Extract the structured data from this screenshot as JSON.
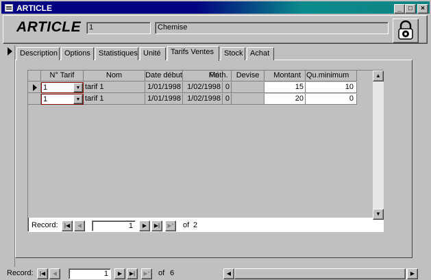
{
  "window": {
    "title": "ARTICLE",
    "min_label": "_",
    "max_label": "□",
    "close_label": "×"
  },
  "form": {
    "title": "ARTICLE",
    "id_value": "1",
    "name_value": "Chemise"
  },
  "tabs": [
    {
      "label": "Description"
    },
    {
      "label": "Options"
    },
    {
      "label": "Statistiques"
    },
    {
      "label": "Unité"
    },
    {
      "label": "Tarifs Ventes",
      "active": true
    },
    {
      "label": "Stock"
    },
    {
      "label": "Achat"
    }
  ],
  "subform": {
    "columns": [
      "N° Tarif",
      "Nom",
      "Date début",
      "Fin",
      "Méth.",
      "Devise",
      "Montant",
      "Qu.minimum"
    ],
    "rows": [
      {
        "tarif": "1",
        "nom": "tarif 1",
        "debut": "1/01/1998",
        "fin": "1/02/1998",
        "meth": "0",
        "devise": "",
        "montant": "15",
        "qmin": "10"
      },
      {
        "tarif": "1",
        "nom": "tarif 1",
        "debut": "1/01/1998",
        "fin": "1/02/1998",
        "meth": "0",
        "devise": "",
        "montant": "20",
        "qmin": "0"
      }
    ],
    "nav": {
      "label": "Record:",
      "current": "1",
      "of": "of",
      "total": "2"
    }
  },
  "mainnav": {
    "label": "Record:",
    "current": "1",
    "of": "of",
    "total": "6"
  },
  "colors": {
    "titlebar_start": "#000080",
    "titlebar_end": "#108484",
    "face": "#c0c0c0"
  }
}
